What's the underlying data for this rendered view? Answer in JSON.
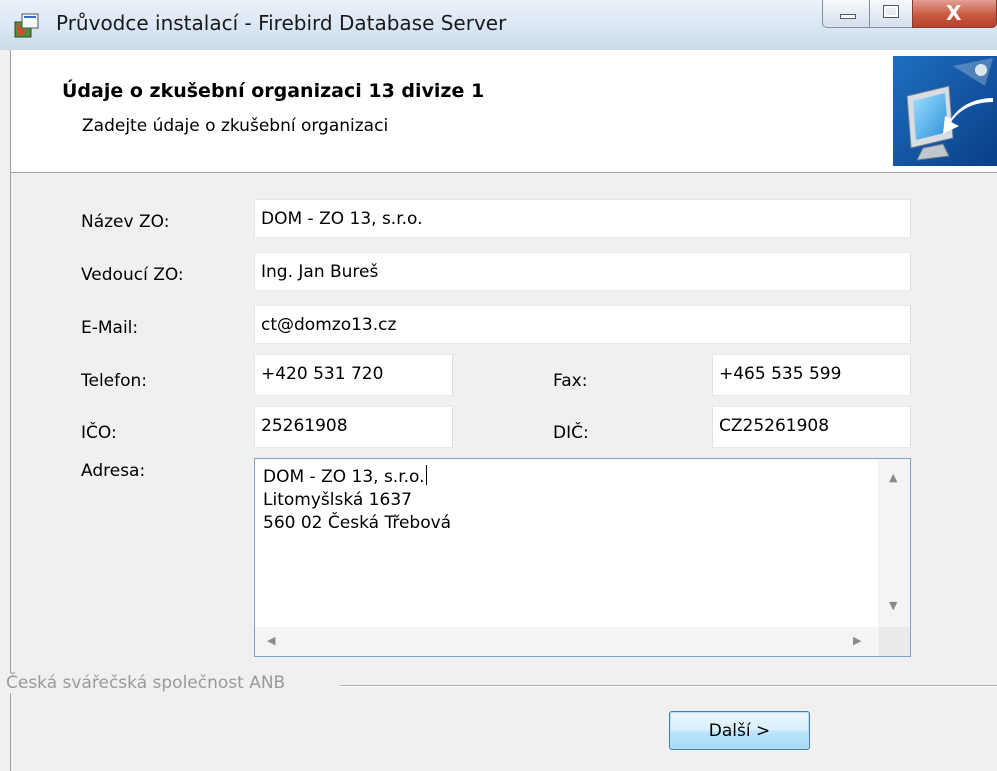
{
  "window": {
    "title": "Průvodce instalací - Firebird Database Server",
    "close_glyph": "X"
  },
  "header": {
    "title": "Údaje o zkušební organizaci 13 divize 1",
    "subtitle": "Zadejte údaje o zkušební organizaci"
  },
  "form": {
    "nazev_label": "Název ZO:",
    "nazev_value": "DOM - ZO 13, s.r.o.",
    "vedouci_label": "Vedoucí ZO:",
    "vedouci_value": "Ing. Jan Bureš",
    "email_label": "E-Mail:",
    "email_value": "ct@domzo13.cz",
    "telefon_label": "Telefon:",
    "telefon_value": "+420 531 720",
    "fax_label": "Fax:",
    "fax_value": "+465 535 599",
    "ico_label": "IČO:",
    "ico_value": "25261908",
    "dic_label": "DIČ:",
    "dic_value": "CZ25261908",
    "adresa_label": "Adresa:",
    "adresa_lines": [
      "DOM - ZO 13, s.r.o.",
      "Litomyšlská 1637",
      "560 02 Česká Třebová"
    ]
  },
  "footer": {
    "group_label": "Česká svářečská společnost ANB",
    "next_label": "Další >"
  },
  "icons": {
    "app": "installer-icon",
    "header": "computer-monitor-icon"
  },
  "colors": {
    "accent": "#3c7fb1",
    "close_button": "#c85a42"
  }
}
